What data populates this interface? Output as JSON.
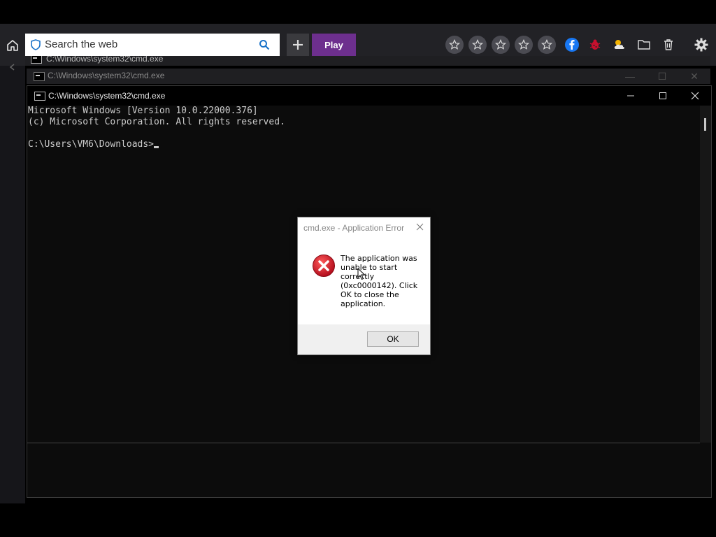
{
  "toolbar": {
    "search_placeholder": "Search the web",
    "play_label": "Play",
    "plus_label": "+",
    "icons": [
      "home-icon",
      "shield-icon",
      "search-icon",
      "star-icon",
      "star-icon",
      "star-icon",
      "star-icon",
      "star-icon",
      "facebook-icon",
      "bug-icon",
      "weather-icon",
      "folder-icon",
      "trash-icon",
      "gear-icon"
    ]
  },
  "background_windows": [
    {
      "title": "C:\\Windows\\system32\\cmd.exe"
    },
    {
      "title": "C:\\Windows\\system32\\cmd.exe"
    }
  ],
  "main_window": {
    "title": "C:\\Windows\\system32\\cmd.exe",
    "console_lines": [
      "Microsoft Windows [Version 10.0.22000.376]",
      "(c) Microsoft Corporation. All rights reserved.",
      "",
      "C:\\Users\\VM6\\Downloads>"
    ]
  },
  "dialog": {
    "title": "cmd.exe - Application Error",
    "message": "The application was unable to start correctly (0xc0000142). Click OK to close the application.",
    "ok_label": "OK"
  },
  "colors": {
    "play_button": "#6d2f8e",
    "console_bg": "#0c0c0c",
    "error_red": "#c8102e",
    "facebook_blue": "#1877f2"
  }
}
